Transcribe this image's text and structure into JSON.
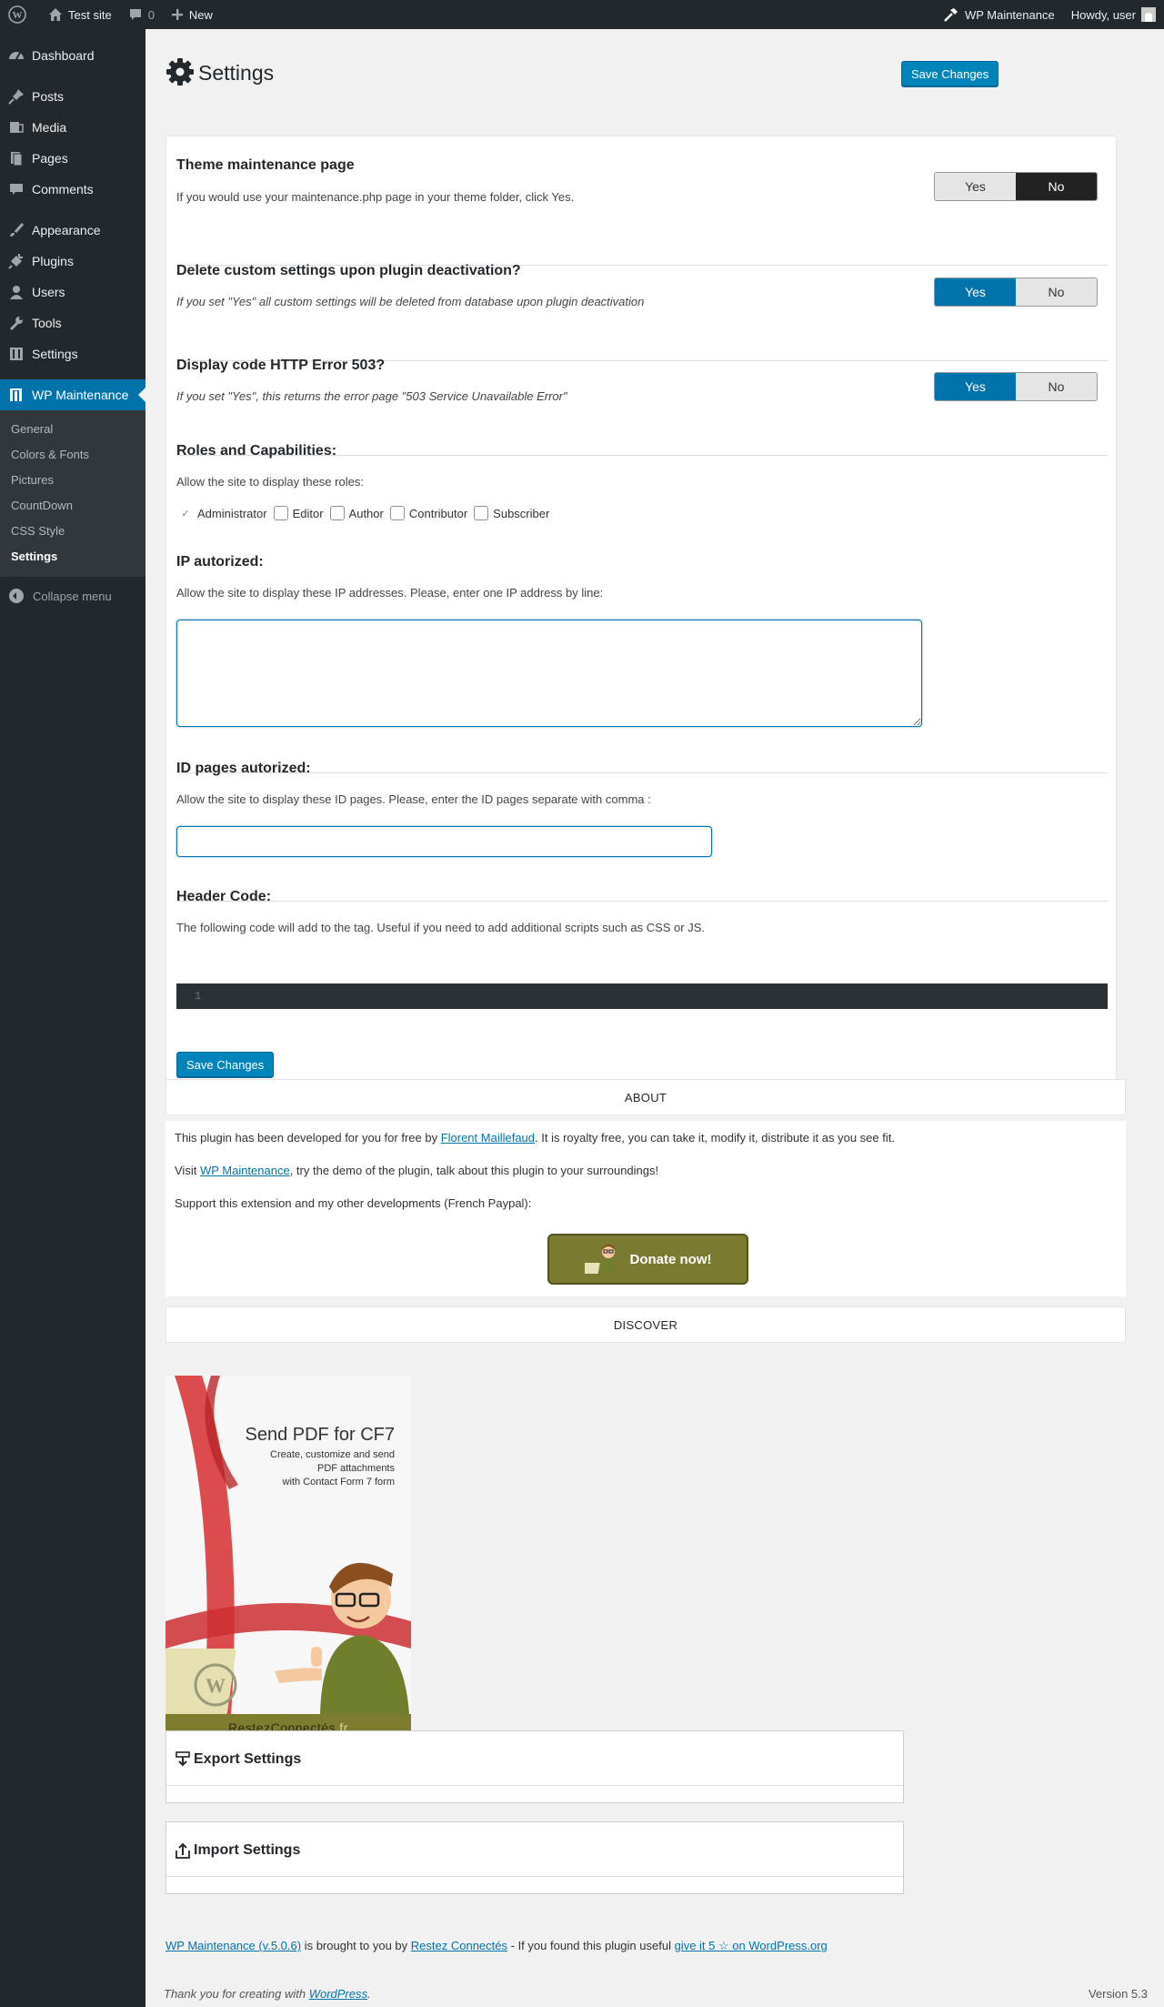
{
  "admin_bar": {
    "site_name": "Test site",
    "comments_count": "0",
    "new_label": "New",
    "plugin_link": "WP Maintenance",
    "greeting": "Howdy, user"
  },
  "sidebar": {
    "items": [
      {
        "label": "Dashboard"
      },
      {
        "label": "Posts"
      },
      {
        "label": "Media"
      },
      {
        "label": "Pages"
      },
      {
        "label": "Comments"
      },
      {
        "label": "Appearance"
      },
      {
        "label": "Plugins"
      },
      {
        "label": "Users"
      },
      {
        "label": "Tools"
      },
      {
        "label": "Settings"
      },
      {
        "label": "WP Maintenance"
      }
    ],
    "submenu": [
      "General",
      "Colors & Fonts",
      "Pictures",
      "CountDown",
      "CSS Style",
      "Settings"
    ],
    "collapse_label": "Collapse menu"
  },
  "page": {
    "title": "Settings",
    "save_label": "Save Changes"
  },
  "settings": {
    "theme_page": {
      "title": "Theme maintenance page",
      "desc": "If you would use your maintenance.php page in your theme folder, click Yes.",
      "yes": "Yes",
      "no": "No",
      "selected": "No"
    },
    "delete_settings": {
      "title": "Delete custom settings upon plugin deactivation?",
      "desc": "If you set \"Yes\" all custom settings will be deleted from database upon plugin deactivation",
      "yes": "Yes",
      "no": "No",
      "selected": "Yes"
    },
    "error_503": {
      "title": "Display code HTTP Error 503?",
      "desc": "If you set \"Yes\", this returns the error page \"503 Service Unavailable Error\"",
      "yes": "Yes",
      "no": "No",
      "selected": "Yes"
    },
    "roles": {
      "title": "Roles and Capabilities:",
      "desc": "Allow the site to display these roles:",
      "items": [
        {
          "label": "Administrator",
          "checked": true
        },
        {
          "label": "Editor",
          "checked": false
        },
        {
          "label": "Author",
          "checked": false
        },
        {
          "label": "Contributor",
          "checked": false
        },
        {
          "label": "Subscriber",
          "checked": false
        }
      ]
    },
    "ip": {
      "title": "IP autorized:",
      "desc": "Allow the site to display these IP addresses. Please, enter one IP address by line:",
      "value": ""
    },
    "id_pages": {
      "title": "ID pages autorized:",
      "desc": "Allow the site to display these ID pages. Please, enter the ID pages separate with comma :",
      "value": ""
    },
    "header_code": {
      "title": "Header Code:",
      "desc": "The following code will add to the tag. Useful if you need to add additional scripts such as CSS or JS.",
      "line_number": "1"
    }
  },
  "about": {
    "heading": "ABOUT",
    "p1_before": "This plugin has been developed for you for free by ",
    "p1_link": "Florent Maillefaud",
    "p1_after": ". It is royalty free, you can take it, modify it, distribute it as you see fit.",
    "p2_before": "Visit ",
    "p2_link": "WP Maintenance",
    "p2_after": ", try the demo of the plugin, talk about this plugin to your surroundings!",
    "p3": "Support this extension and my other developments (French Paypal):",
    "donate_label": "Donate now!"
  },
  "discover": {
    "heading": "DISCOVER",
    "ad_title": "Send PDF for CF7",
    "ad_line1": "Create, customize and send",
    "ad_line2": "PDF attachments",
    "ad_line3": "with Contact Form 7 form",
    "ad_brand": "RestezConnectés",
    "ad_brand_tld": ".fr"
  },
  "tools": {
    "export_title": "Export Settings",
    "import_title": "Import Settings"
  },
  "credits": {
    "plugin_link": "WP Maintenance (v.5.0.6)",
    "mid1": " is brought to you by ",
    "author_link": "Restez Connectés",
    "mid2": " - If you found this plugin useful ",
    "rate_link": "give it 5 ☆ on WordPress.org"
  },
  "footer": {
    "thanks_before": "Thank you for creating with ",
    "wp_link": "WordPress",
    "thanks_after": ".",
    "version": "Version 5.3"
  },
  "colors": {
    "admin_bar": "#23282d",
    "accent": "#0073aa",
    "donate_bg": "#7a7a30"
  }
}
